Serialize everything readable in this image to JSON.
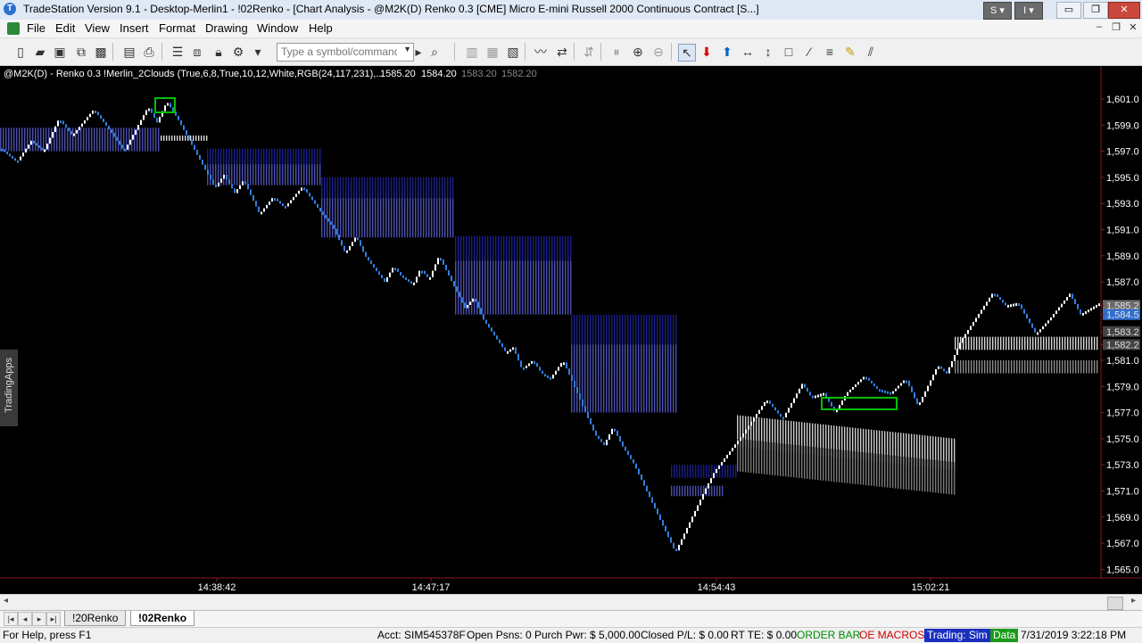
{
  "window": {
    "title": "TradeStation Version 9.1 - Desktop-Merlin1 - !02Renko - [Chart Analysis - @M2K(D) Renko 0.3 [CME] Micro E-mini Russell 2000 Continuous Contract [S...]",
    "app_icon": "tradestation-icon",
    "dropdown_s": "S",
    "dropdown_i": "I",
    "min_glyph": "▭",
    "restore_glyph": "❐",
    "close_glyph": "✕"
  },
  "menu": {
    "items": [
      "File",
      "Edit",
      "View",
      "Insert",
      "Format",
      "Drawing",
      "Window",
      "Help"
    ],
    "mdi_min": "–",
    "mdi_restore": "❐",
    "mdi_close": "✕"
  },
  "toolbar": {
    "symbol_placeholder": "Type a symbol/command",
    "icons": [
      "new-icon",
      "open-icon",
      "open-folder-icon",
      "workspace-icon",
      "lock-icon",
      "print-icon",
      "printer-icon",
      "format-icon",
      "copy-icon",
      "lock2-icon",
      "share-icon",
      "dropdown-icon",
      "go-icon",
      "search-icon",
      "bars-icon",
      "renko-icon",
      "crosshair-icon",
      "compare-icon",
      "link-icon",
      "pause-icon",
      "zoom-in-icon",
      "zoom-out-icon",
      "pointer-icon",
      "buy-arrow-icon",
      "sell-arrow-icon",
      "horizontal-line-icon",
      "vertical-line-icon",
      "rectangle-icon",
      "trendline-icon",
      "menu-lines-icon",
      "marker-icon",
      "channel-icon"
    ]
  },
  "chart": {
    "header": "@M2K(D) - Renko 0.3  !Merlin_2Clouds (True,6,8,True,10,12,White,RGB(24,117,231),...",
    "header_values": [
      "1585.20",
      "1584.20"
    ],
    "header_values_dim": [
      "1583.20",
      "1582.20"
    ],
    "y_ticks": [
      "1,601.0",
      "1,599.0",
      "1,597.0",
      "1,595.0",
      "1,593.0",
      "1,591.0",
      "1,589.0",
      "1,587.0",
      "1,585.2",
      "1,584.5",
      "1,583.2",
      "1,582.2",
      "1,581.0",
      "1,579.0",
      "1,577.0",
      "1,575.0",
      "1,573.0",
      "1,571.0",
      "1,569.0",
      "1,567.0",
      "1,565.0"
    ],
    "x_ticks": [
      "14:38:42",
      "14:47:17",
      "14:54:43",
      "15:02:21"
    ],
    "side_tab": "TradingApps",
    "colors": {
      "background": "#000000",
      "up": "#ffffff",
      "down": "#2f7fe0",
      "cloud_dark": "#1a1f8a",
      "cloud_mid": "#4a4fb0",
      "signal": "#00c000"
    }
  },
  "chart_data": {
    "type": "line",
    "title": "@M2K(D) - Renko 0.3",
    "ylim": [
      1564,
      1602.5
    ],
    "x": [],
    "series": []
  },
  "tabs": {
    "sheets": [
      "!20Renko",
      "!02Renko"
    ],
    "active": "!02Renko",
    "nav": [
      "|◂",
      "◂",
      "▸",
      "▸|"
    ]
  },
  "status": {
    "help": "For Help, press F1",
    "acct": "Acct: SIM545378F",
    "open_psns": "Open Psns: 0",
    "purch_pwr": "Purch Pwr: $ 5,000.00",
    "closed_pl": "Closed P/L: $ 0.00",
    "rt_te": "RT TE: $ 0.00",
    "order_bar": "ORDER BAR",
    "oe_macros": "OE MACROS",
    "trading": "Trading: Sim",
    "data": "Data",
    "datetime": "7/31/2019 3:22:18 PM"
  }
}
